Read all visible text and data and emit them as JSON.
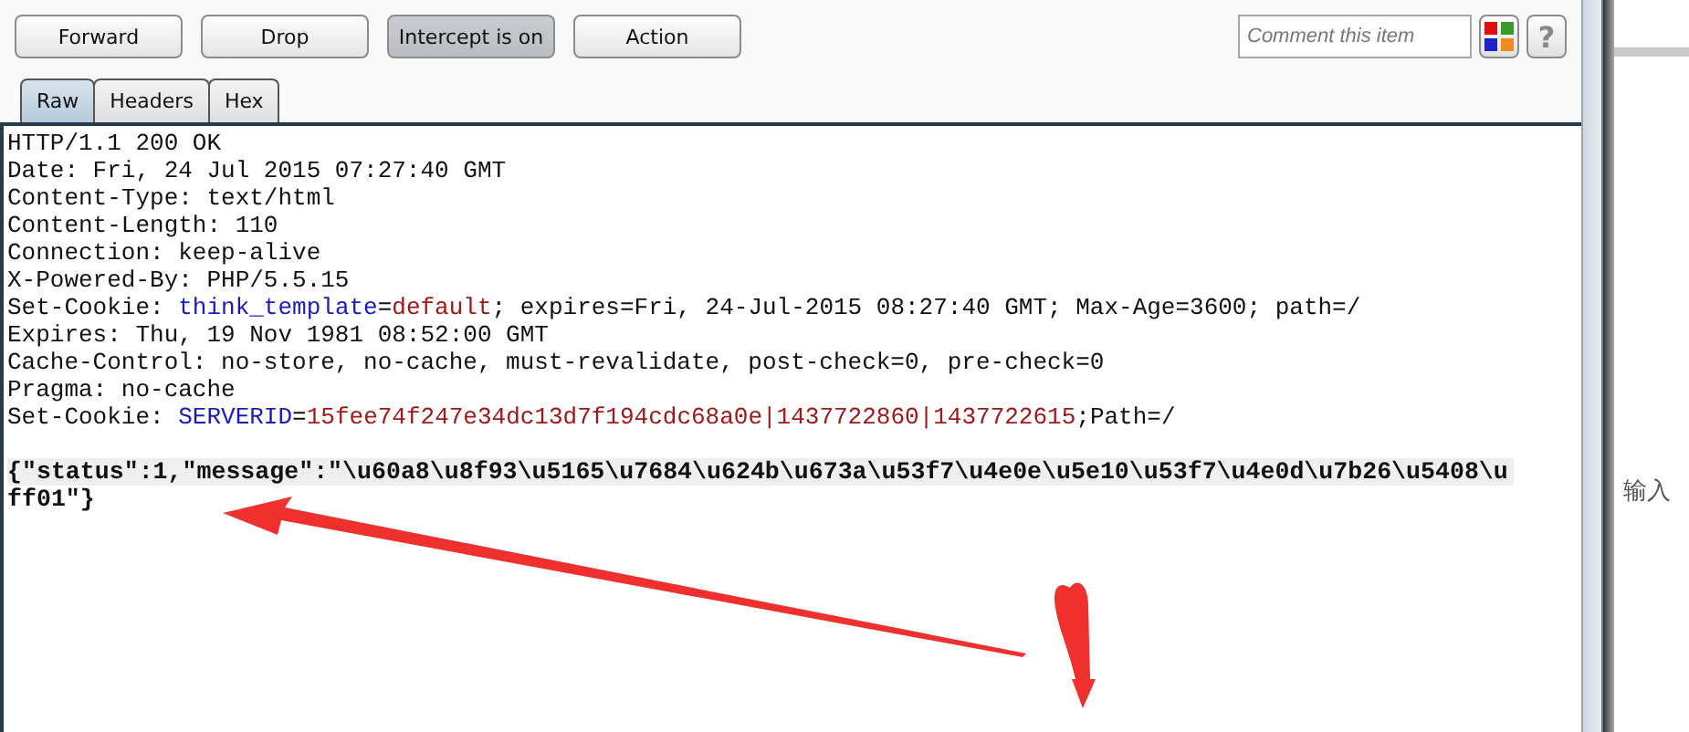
{
  "toolbar": {
    "buttons": [
      {
        "label": "Forward",
        "pressed": false
      },
      {
        "label": "Drop",
        "pressed": false
      },
      {
        "label": "Intercept is on",
        "pressed": true
      },
      {
        "label": "Action",
        "pressed": false
      }
    ],
    "comment": {
      "placeholder": "Comment this item"
    },
    "help": "?"
  },
  "tabs": [
    {
      "label": "Raw",
      "selected": true
    },
    {
      "label": "Headers",
      "selected": false
    },
    {
      "label": "Hex",
      "selected": false
    }
  ],
  "response_lines": [
    [
      {
        "kind": "plain",
        "text": "HTTP/1.1 200 OK"
      }
    ],
    [
      {
        "kind": "plain",
        "text": "Date: Fri, 24 Jul 2015 07:27:40 GMT"
      }
    ],
    [
      {
        "kind": "plain",
        "text": "Content-Type: text/html"
      }
    ],
    [
      {
        "kind": "plain",
        "text": "Content-Length: 110"
      }
    ],
    [
      {
        "kind": "plain",
        "text": "Connection: keep-alive"
      }
    ],
    [
      {
        "kind": "plain",
        "text": "X-Powered-By: PHP/5.5.15"
      }
    ],
    [
      {
        "kind": "plain",
        "text": "Set-Cookie: "
      },
      {
        "kind": "name",
        "text": "think_template"
      },
      {
        "kind": "plain",
        "text": "="
      },
      {
        "kind": "value",
        "text": "default"
      },
      {
        "kind": "plain",
        "text": "; expires=Fri, 24-Jul-2015 08:27:40 GMT; Max-Age=3600; path=/"
      }
    ],
    [
      {
        "kind": "plain",
        "text": "Expires: Thu, 19 Nov 1981 08:52:00 GMT"
      }
    ],
    [
      {
        "kind": "plain",
        "text": "Cache-Control: no-store, no-cache, must-revalidate, post-check=0, pre-check=0"
      }
    ],
    [
      {
        "kind": "plain",
        "text": "Pragma: no-cache"
      }
    ],
    [
      {
        "kind": "plain",
        "text": "Set-Cookie: "
      },
      {
        "kind": "name",
        "text": "SERVERID"
      },
      {
        "kind": "plain",
        "text": "="
      },
      {
        "kind": "value",
        "text": "15fee74f247e34dc13d7f194cdc68a0e|1437722860|1437722615"
      },
      {
        "kind": "plain",
        "text": ";Path=/"
      }
    ]
  ],
  "response_body": "{\"status\":1,\"message\":\"\\u60a8\\u8f93\\u5165\\u7684\\u624b\\u673a\\u53f7\\u4e0e\\u5e10\\u53f7\\u4e0d\\u7b26\\u5408\\uff01\"}",
  "side_text": "输入"
}
